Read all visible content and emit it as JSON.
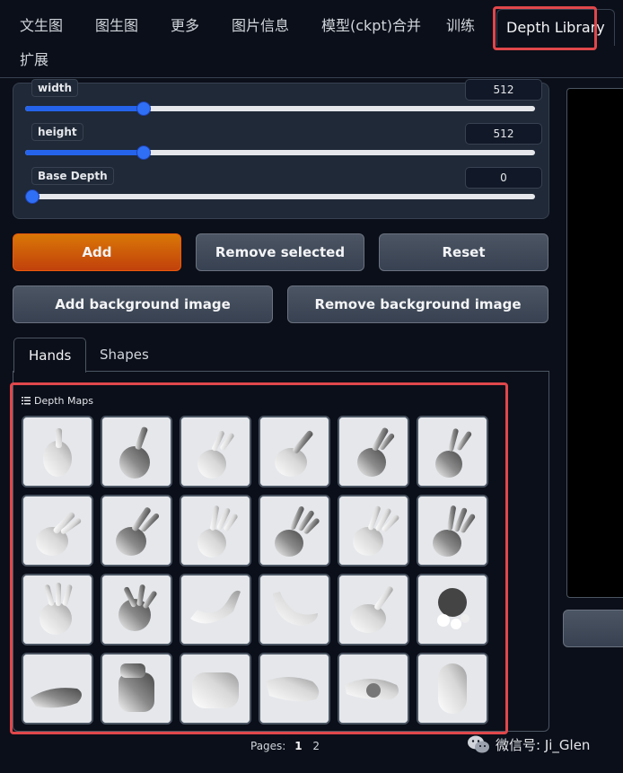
{
  "nav": {
    "tabs": [
      "文生图",
      "图生图",
      "更多",
      "图片信息",
      "模型(ckpt)合并",
      "训练",
      "Depth Library",
      "扩展"
    ],
    "active_tab": "Depth Library"
  },
  "sliders": [
    {
      "label": "width",
      "value": "512",
      "fraction": 0.216
    },
    {
      "label": "height",
      "value": "512",
      "fraction": 0.216
    },
    {
      "label": "Base Depth",
      "value": "0",
      "fraction": 0.0
    }
  ],
  "buttons": {
    "add": "Add",
    "remove_selected": "Remove selected",
    "reset": "Reset",
    "add_background": "Add background image",
    "remove_background": "Remove background image"
  },
  "subtabs": [
    "Hands",
    "Shapes"
  ],
  "gallery": {
    "label": "Depth Maps",
    "rows": 4,
    "cols": 6,
    "pages_label": "Pages:",
    "pages": [
      "1",
      "2"
    ],
    "current_page": "1"
  },
  "watermark": "微信号: Ji_Glen",
  "colors": {
    "accent": "#2563eb",
    "primary_button": "#d97706",
    "highlight_outline": "#e0474b",
    "background": "#0b0f19"
  }
}
